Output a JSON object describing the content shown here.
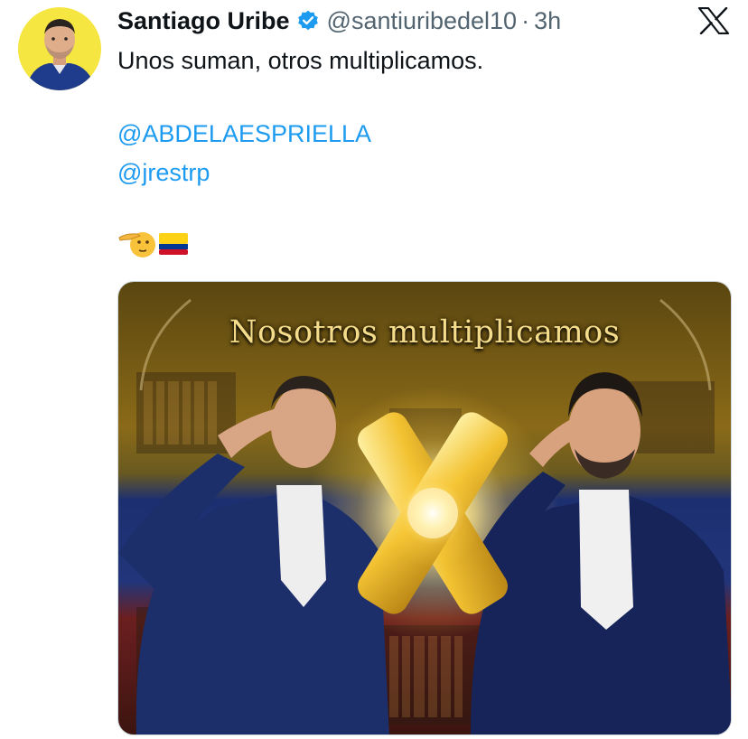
{
  "tweet": {
    "author": {
      "display_name": "Santiago Uribe",
      "handle": "@santiuribedel10",
      "separator": "·",
      "time": "3h",
      "avatar_icon": "user-avatar-photo",
      "verified_icon": "verified-badge-icon",
      "verified_color": "#1d9bf0"
    },
    "platform_icon": "x-logo-icon",
    "text_line": "Unos suman, otros multiplicamos.",
    "mentions": [
      "@ABDELAESPRIELLA",
      "@jrestrp"
    ],
    "emojis": [
      "saluting-hand-emoji",
      "colombia-flag-emoji"
    ],
    "media": {
      "title": "Nosotros multiplicamos",
      "center_symbol_icon": "golden-x-icon"
    }
  },
  "colors": {
    "text_primary": "#0f1419",
    "text_secondary": "#536471",
    "link": "#1d9bf0",
    "avatar_background": "#f5e642"
  }
}
